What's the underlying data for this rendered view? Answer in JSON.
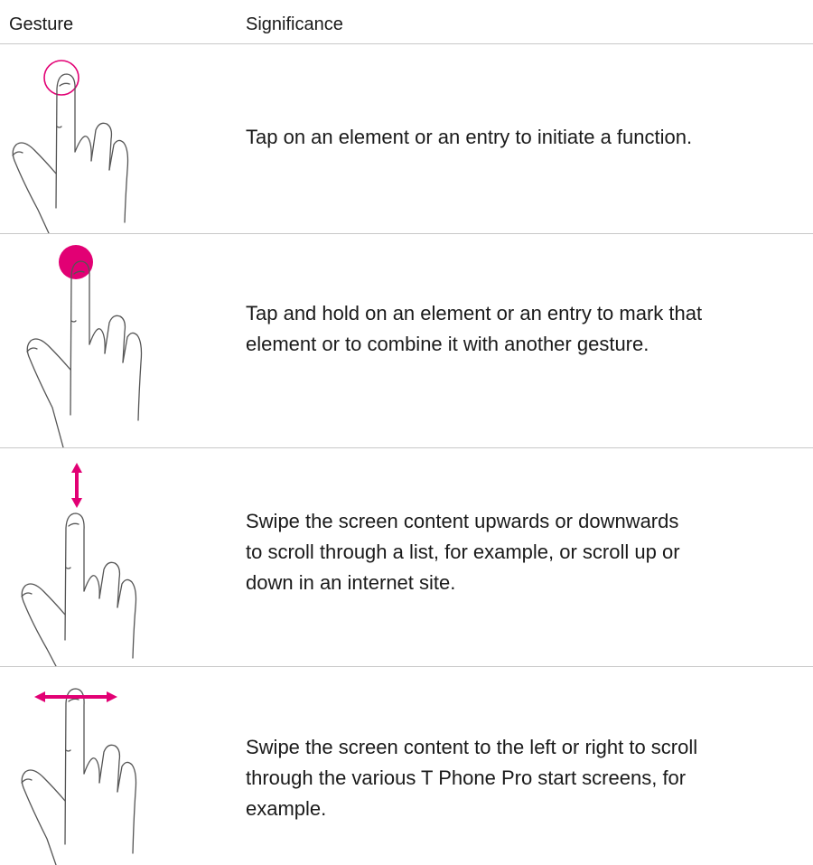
{
  "header": {
    "gesture": "Gesture",
    "significance": "Significance"
  },
  "colors": {
    "accent": "#e20074",
    "rule": "#c8c8c8",
    "text": "#1a1a1a"
  },
  "rows": [
    {
      "gesture_icon": "tap-icon",
      "text": "Tap on an element or an entry to initiate a function."
    },
    {
      "gesture_icon": "tap-and-hold-icon",
      "text": "Tap and hold on an element or an entry to mark that\nelement or to combine it with another gesture."
    },
    {
      "gesture_icon": "swipe-vertical-icon",
      "text": "Swipe the screen content upwards or downwards\nto scroll through a list, for example, or scroll up or\ndown in an internet site."
    },
    {
      "gesture_icon": "swipe-horizontal-icon",
      "text": "Swipe the screen content to the left or right to scroll\nthrough the various T Phone Pro start screens, for\nexample."
    }
  ]
}
